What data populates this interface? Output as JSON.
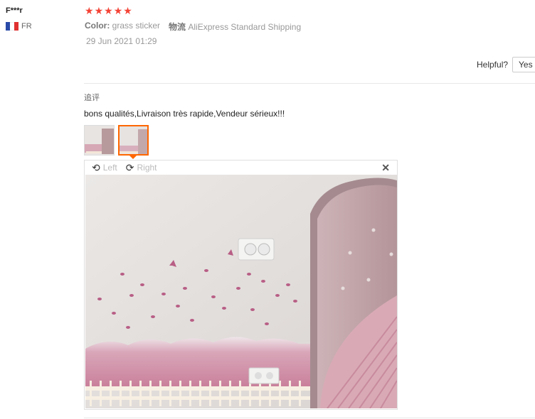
{
  "review": {
    "user": "F***r",
    "country": "FR",
    "rating": 5,
    "color_key": "Color:",
    "color_value": "grass sticker",
    "shipping_key": "物流",
    "shipping_value": "AliExpress Standard Shipping",
    "date": "29 Jun 2021 01:29"
  },
  "helpful": {
    "label": "Helpful?",
    "yes": "Yes"
  },
  "followup": {
    "label": "追评",
    "text": "bons qualités,Livraison très rapide,Vendeur sérieux!!!"
  },
  "viewer": {
    "left_label": "Left",
    "right_label": "Right"
  },
  "colors": {
    "star": "#f44336",
    "active_border": "#ff6600"
  }
}
